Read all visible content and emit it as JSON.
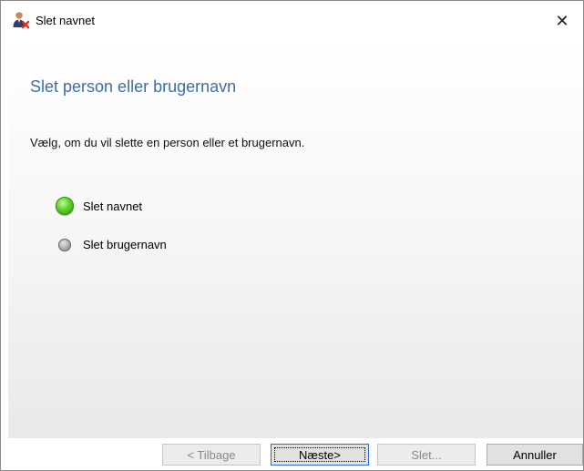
{
  "window": {
    "title": "Slet navnet"
  },
  "content": {
    "heading": "Slet person eller brugernavn",
    "instruction": "Vælg, om du vil slette en person eller et brugernavn.",
    "options": [
      {
        "label": "Slet navnet",
        "selected": true
      },
      {
        "label": "Slet brugernavn",
        "selected": false
      }
    ]
  },
  "buttons": {
    "back": "< Tilbage",
    "next": "Næste>",
    "delete": "Slet...",
    "cancel": "Annuller"
  },
  "colors": {
    "heading": "#3d6fa3",
    "selected_radio": "#3cc21a",
    "unselected_radio": "#8a8a8a"
  }
}
